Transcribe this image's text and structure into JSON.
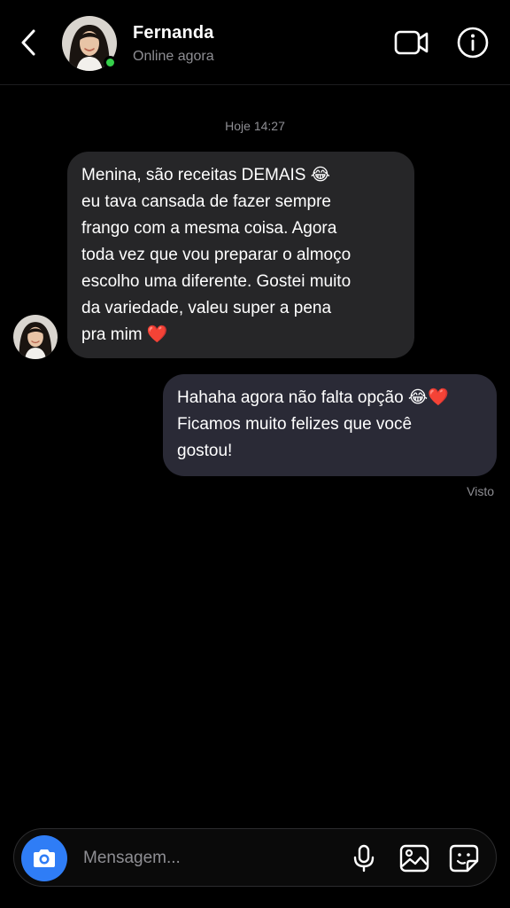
{
  "header": {
    "contact_name": "Fernanda",
    "status": "Online agora",
    "back_icon": "chevron-left-icon",
    "video_icon": "video-camera-icon",
    "info_icon": "info-icon",
    "online_color": "#36d04b"
  },
  "conversation": {
    "timestamp": "Hoje 14:27",
    "messages": [
      {
        "direction": "incoming",
        "lines": [
          "Menina, são receitas DEMAIS 😂",
          "eu tava cansada de fazer sempre",
          "frango com a mesma coisa. Agora",
          "toda vez que vou preparar o almoço",
          "escolho uma diferente. Gostei muito",
          "da variedade, valeu super a pena",
          "pra mim ❤️"
        ]
      },
      {
        "direction": "outgoing",
        "lines": [
          "Hahaha agora não falta opção 😂❤️",
          "Ficamos muito felizes que você",
          "gostou!"
        ]
      }
    ],
    "seen_label": "Visto"
  },
  "composer": {
    "placeholder": "Mensagem...",
    "camera_icon": "camera-icon",
    "mic_icon": "microphone-icon",
    "gallery_icon": "image-gallery-icon",
    "sticker_icon": "sticker-icon",
    "accent_color": "#2f7df6"
  },
  "theme": {
    "background": "#000000",
    "incoming_bubble": "#262628",
    "outgoing_bubble": "#2a2a36",
    "muted_text": "#8e8e93"
  }
}
